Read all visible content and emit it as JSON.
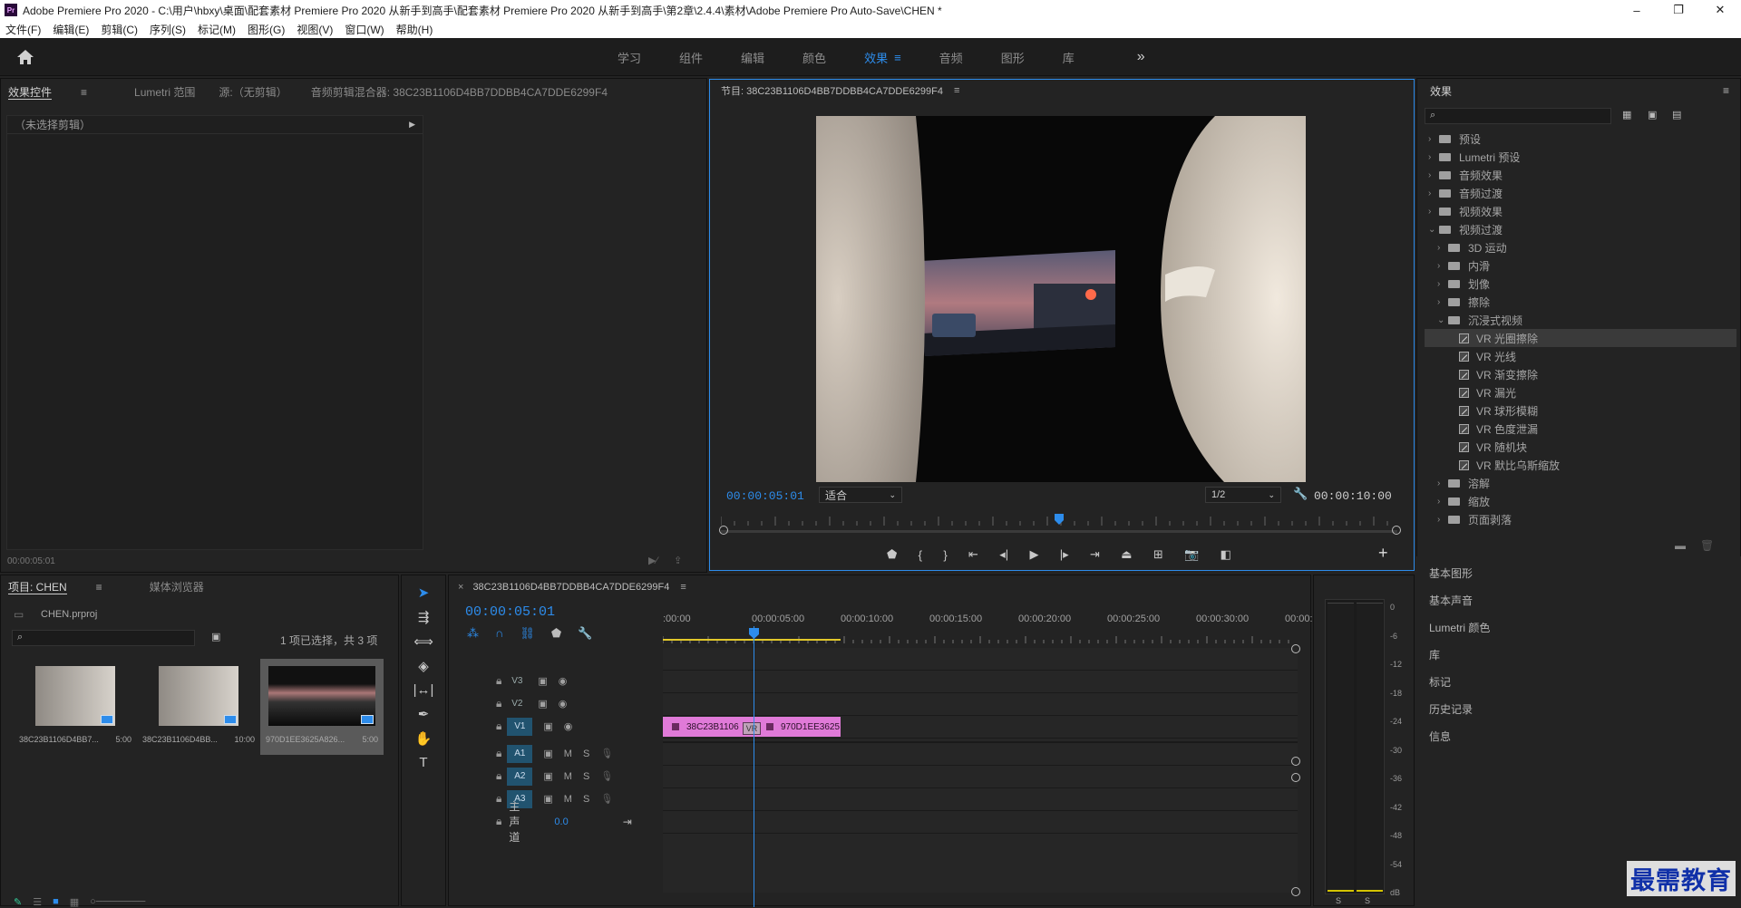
{
  "window": {
    "title": "Adobe Premiere Pro 2020 - C:\\用户\\hbxy\\桌面\\配套素材 Premiere Pro 2020 从新手到高手\\配套素材 Premiere Pro 2020 从新手到高手\\第2章\\2.4.4\\素材\\Adobe Premiere Pro Auto-Save\\CHEN *",
    "app_icon": "Pr",
    "controls": [
      "–",
      "❐",
      "✕"
    ]
  },
  "menu": [
    "文件(F)",
    "编辑(E)",
    "剪辑(C)",
    "序列(S)",
    "标记(M)",
    "图形(G)",
    "视图(V)",
    "窗口(W)",
    "帮助(H)"
  ],
  "workspaces": {
    "tabs": [
      "学习",
      "组件",
      "编辑",
      "颜色",
      "效果",
      "音频",
      "图形",
      "库"
    ],
    "active": "效果",
    "more": "»"
  },
  "source_panel": {
    "tabs": [
      "效果控件",
      "Lumetri 范围",
      "源:（无剪辑）",
      "音频剪辑混合器: 38C23B1106D4BB7DDBB4CA7DDE6299F4"
    ],
    "no_clip": "（未选择剪辑）",
    "timecode": "00:00:05:01"
  },
  "program": {
    "title": "节目: 38C23B1106D4BB7DDBB4CA7DDE6299F4",
    "timecode": "00:00:05:01",
    "fit": "适合",
    "resolution": "1/2",
    "duration": "00:00:10:00",
    "playhead_fraction": 0.5
  },
  "effects": {
    "title": "效果",
    "tree": [
      {
        "label": "预设",
        "level": 0,
        "type": "folder-star",
        "open": false
      },
      {
        "label": "Lumetri 预设",
        "level": 0,
        "type": "folder-star",
        "open": false
      },
      {
        "label": "音频效果",
        "level": 0,
        "type": "folder",
        "open": false
      },
      {
        "label": "音频过渡",
        "level": 0,
        "type": "folder",
        "open": false
      },
      {
        "label": "视频效果",
        "level": 0,
        "type": "folder",
        "open": false
      },
      {
        "label": "视频过渡",
        "level": 0,
        "type": "folder",
        "open": true
      },
      {
        "label": "3D 运动",
        "level": 1,
        "type": "folder",
        "open": false
      },
      {
        "label": "内滑",
        "level": 1,
        "type": "folder",
        "open": false
      },
      {
        "label": "划像",
        "level": 1,
        "type": "folder",
        "open": false
      },
      {
        "label": "擦除",
        "level": 1,
        "type": "folder",
        "open": false
      },
      {
        "label": "沉浸式视频",
        "level": 1,
        "type": "folder",
        "open": true
      },
      {
        "label": "VR 光圈擦除",
        "level": 2,
        "type": "fx",
        "selected": true
      },
      {
        "label": "VR 光线",
        "level": 2,
        "type": "fx"
      },
      {
        "label": "VR 渐变擦除",
        "level": 2,
        "type": "fx"
      },
      {
        "label": "VR 漏光",
        "level": 2,
        "type": "fx"
      },
      {
        "label": "VR 球形模糊",
        "level": 2,
        "type": "fx"
      },
      {
        "label": "VR 色度泄漏",
        "level": 2,
        "type": "fx"
      },
      {
        "label": "VR 随机块",
        "level": 2,
        "type": "fx"
      },
      {
        "label": "VR 默比乌斯缩放",
        "level": 2,
        "type": "fx"
      },
      {
        "label": "溶解",
        "level": 1,
        "type": "folder",
        "open": false
      },
      {
        "label": "缩放",
        "level": 1,
        "type": "folder",
        "open": false
      },
      {
        "label": "页面剥落",
        "level": 1,
        "type": "folder",
        "open": false
      }
    ],
    "collapsed_panels": [
      "基本图形",
      "基本声音",
      "Lumetri 颜色",
      "库",
      "标记",
      "历史记录",
      "信息"
    ]
  },
  "project": {
    "tabs": [
      "项目: CHEN",
      "媒体浏览器"
    ],
    "file": "CHEN.prproj",
    "selection_status": "1 项已选择，共 3 项",
    "items": [
      {
        "name": "38C23B1106D4BB7...",
        "duration": "5:00",
        "kind": "light"
      },
      {
        "name": "38C23B1106D4BB...",
        "duration": "10:00",
        "kind": "light"
      },
      {
        "name": "970D1EE3625A826...",
        "duration": "5:00",
        "kind": "dark",
        "selected": true
      }
    ]
  },
  "timeline": {
    "title": "38C23B1106D4BB7DDBB4CA7DDE6299F4",
    "close": "×",
    "timecode": "00:00:05:01",
    "ruler": [
      ":00:00",
      "00:00:05:00",
      "00:00:10:00",
      "00:00:15:00",
      "00:00:20:00",
      "00:00:25:00",
      "00:00:30:00",
      "00:00:"
    ],
    "video_tracks": [
      "V3",
      "V2",
      "V1"
    ],
    "audio_tracks": [
      "A1",
      "A2",
      "A3"
    ],
    "audio_btns": [
      "M",
      "S"
    ],
    "master": {
      "label": "主声道",
      "value": "0.0"
    },
    "clips": [
      {
        "label": "38C23B1106",
        "color": "#e07ad8"
      },
      {
        "label": "970D1EE3625",
        "color": "#e07ad8"
      }
    ],
    "transition_label": "VR"
  },
  "meter": {
    "labels": [
      "0",
      "-6",
      "-12",
      "-18",
      "-24",
      "-30",
      "-36",
      "-42",
      "-48",
      "-54",
      "dB"
    ],
    "channels": [
      "S",
      "S"
    ]
  },
  "watermark": "最需教育",
  "colors": {
    "accent": "#2d8ceb",
    "clip": "#e07ad8",
    "track_on": "#21536f",
    "selected_row": "#3a3a3a"
  }
}
